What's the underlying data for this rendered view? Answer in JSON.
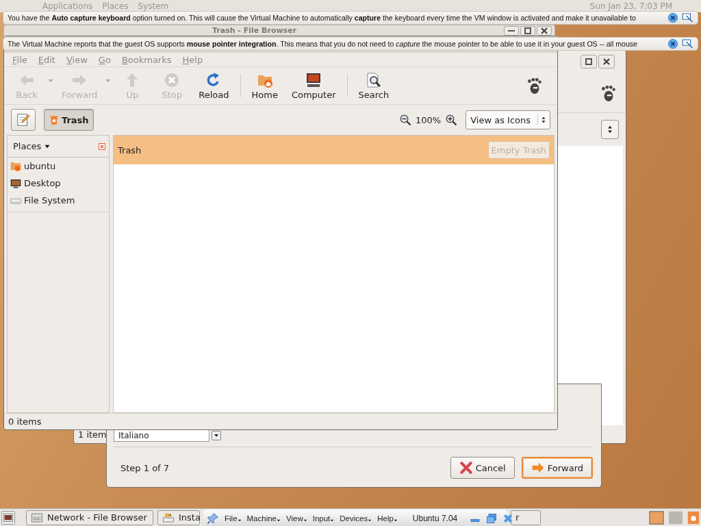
{
  "top_panel": {
    "menus": [
      "Applications",
      "Places",
      "System"
    ],
    "clock": "Sun Jan 23,  7:03 PM"
  },
  "notifications": [
    {
      "text": "You have the **Auto capture keyboard** option turned on. This will cause the Virtual Machine to automatically **capture** the keyboard every time the VM window is activated and make it unavailable to"
    },
    {
      "text": "The Virtual Machine reports that the guest OS supports **mouse pointer integration**. This means that you do not need to *capture* the mouse pointer to be able to use it in your guest OS -- all mouse"
    }
  ],
  "back_window": {
    "title": "Trash - File Browser"
  },
  "second_window": {
    "status": "1 item"
  },
  "installer": {
    "field_value": "Italiano",
    "step": "Step 1 of 7",
    "buttons": [
      {
        "label": "Cancel",
        "kind": "cancel",
        "focused": false
      },
      {
        "label": "Forward",
        "kind": "forward",
        "focused": true
      }
    ]
  },
  "file_browser": {
    "menu": [
      "File",
      "Edit",
      "View",
      "Go",
      "Bookmarks",
      "Help"
    ],
    "toolbar_groups": [
      [
        {
          "label": "Back",
          "disabled": true,
          "dropdown": true
        },
        {
          "label": "Forward",
          "disabled": true,
          "dropdown": true
        },
        {
          "label": "Up",
          "disabled": true,
          "dropdown": false
        },
        {
          "label": "Stop",
          "disabled": true,
          "dropdown": false
        },
        {
          "label": "Reload",
          "disabled": false,
          "dropdown": false
        }
      ],
      [
        {
          "label": "Home",
          "disabled": false,
          "dropdown": false
        },
        {
          "label": "Computer",
          "disabled": false,
          "dropdown": false
        }
      ],
      [
        {
          "label": "Search",
          "disabled": false,
          "dropdown": false
        }
      ]
    ],
    "location_button": {
      "label": "Trash",
      "selected": true
    },
    "zoom": "100%",
    "view_select": "View as Icons",
    "sidebar": {
      "title": "Places",
      "items": [
        {
          "label": "ubuntu"
        },
        {
          "label": "Desktop"
        },
        {
          "label": "File System"
        }
      ]
    },
    "location_title": "Trash",
    "empty_button": {
      "label": "Empty Trash",
      "disabled": true
    },
    "status": "0 items"
  },
  "taskbar": {
    "items": [
      {
        "label": "Network - File Browser"
      },
      {
        "label": "Insta"
      },
      {
        "label": "r"
      }
    ],
    "vm_menu": [
      "File",
      "Machine",
      "View",
      "Input",
      "Devices",
      "Help"
    ],
    "vm_name": "Ubuntu 7.04"
  }
}
